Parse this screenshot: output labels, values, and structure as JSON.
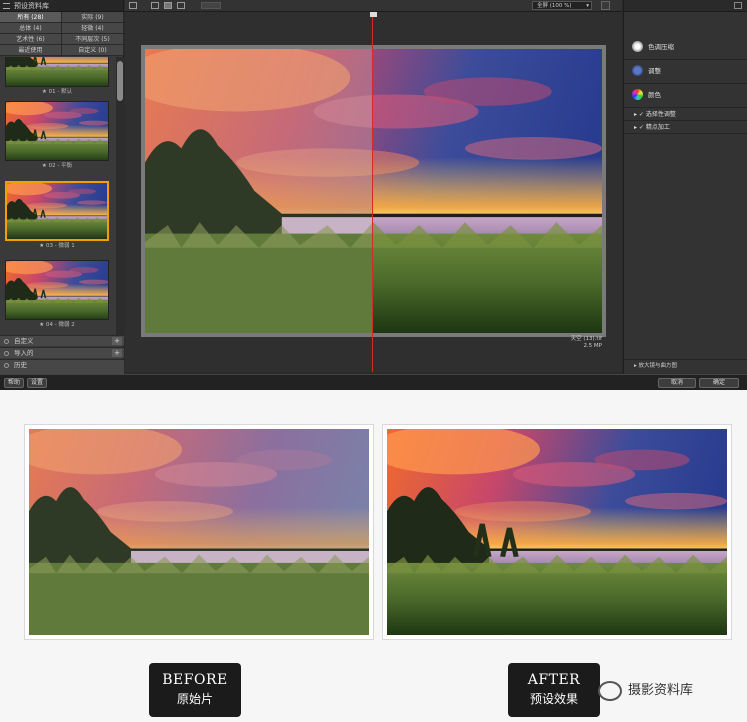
{
  "app": {
    "left_panel": {
      "title": "预设资料库",
      "categories": [
        {
          "label": "所有 (28)"
        },
        {
          "label": "实际 (9)"
        },
        {
          "label": "总体 (4)"
        },
        {
          "label": "轻微 (4)"
        },
        {
          "label": "艺术性 (6)"
        },
        {
          "label": "不同层次 (5)"
        },
        {
          "label": "最近使用"
        },
        {
          "label": "自定义 (0)"
        }
      ],
      "presets": [
        {
          "label": "★ 01 - 默认"
        },
        {
          "label": "★ 02 - 平衡"
        },
        {
          "label": "★ 03 - 微弱 1"
        },
        {
          "label": "★ 04 - 微弱 2"
        }
      ],
      "sections": [
        {
          "label": "自定义"
        },
        {
          "label": "导入的"
        },
        {
          "label": "历史"
        }
      ]
    },
    "toolbar": {
      "zoom_label": "全屏 (100 %)",
      "zoom_arrow": "▾"
    },
    "preview": {
      "info_line1": "天空 (13).tif",
      "info_line2": "2.5 MP"
    },
    "right_panel": {
      "sections": [
        {
          "label": "色调压缩",
          "icon": "sun-icon"
        },
        {
          "label": "调整",
          "icon": "details-icon"
        },
        {
          "label": "颜色",
          "icon": "color-wheel-icon"
        }
      ],
      "sub_sections": [
        {
          "label": "▸ ✓ 选择性调整"
        },
        {
          "label": "▸ ✓ 精点加工"
        }
      ],
      "footer": "▸ 放大镜与曲方图"
    },
    "bottom_bar": {
      "help_label": "帮助",
      "presets_label": "设置",
      "cancel_label": "取消",
      "ok_label": "确定"
    }
  },
  "comparison": {
    "before_en": "BEFORE",
    "before_cn": "原始片",
    "after_en": "AFTER",
    "after_cn": "预设效果",
    "watermark": "摄影资料库"
  },
  "colors": {
    "accent_orange": "#f2a000",
    "split_red": "#d42b22",
    "app_bg": "#2b2b2b"
  }
}
